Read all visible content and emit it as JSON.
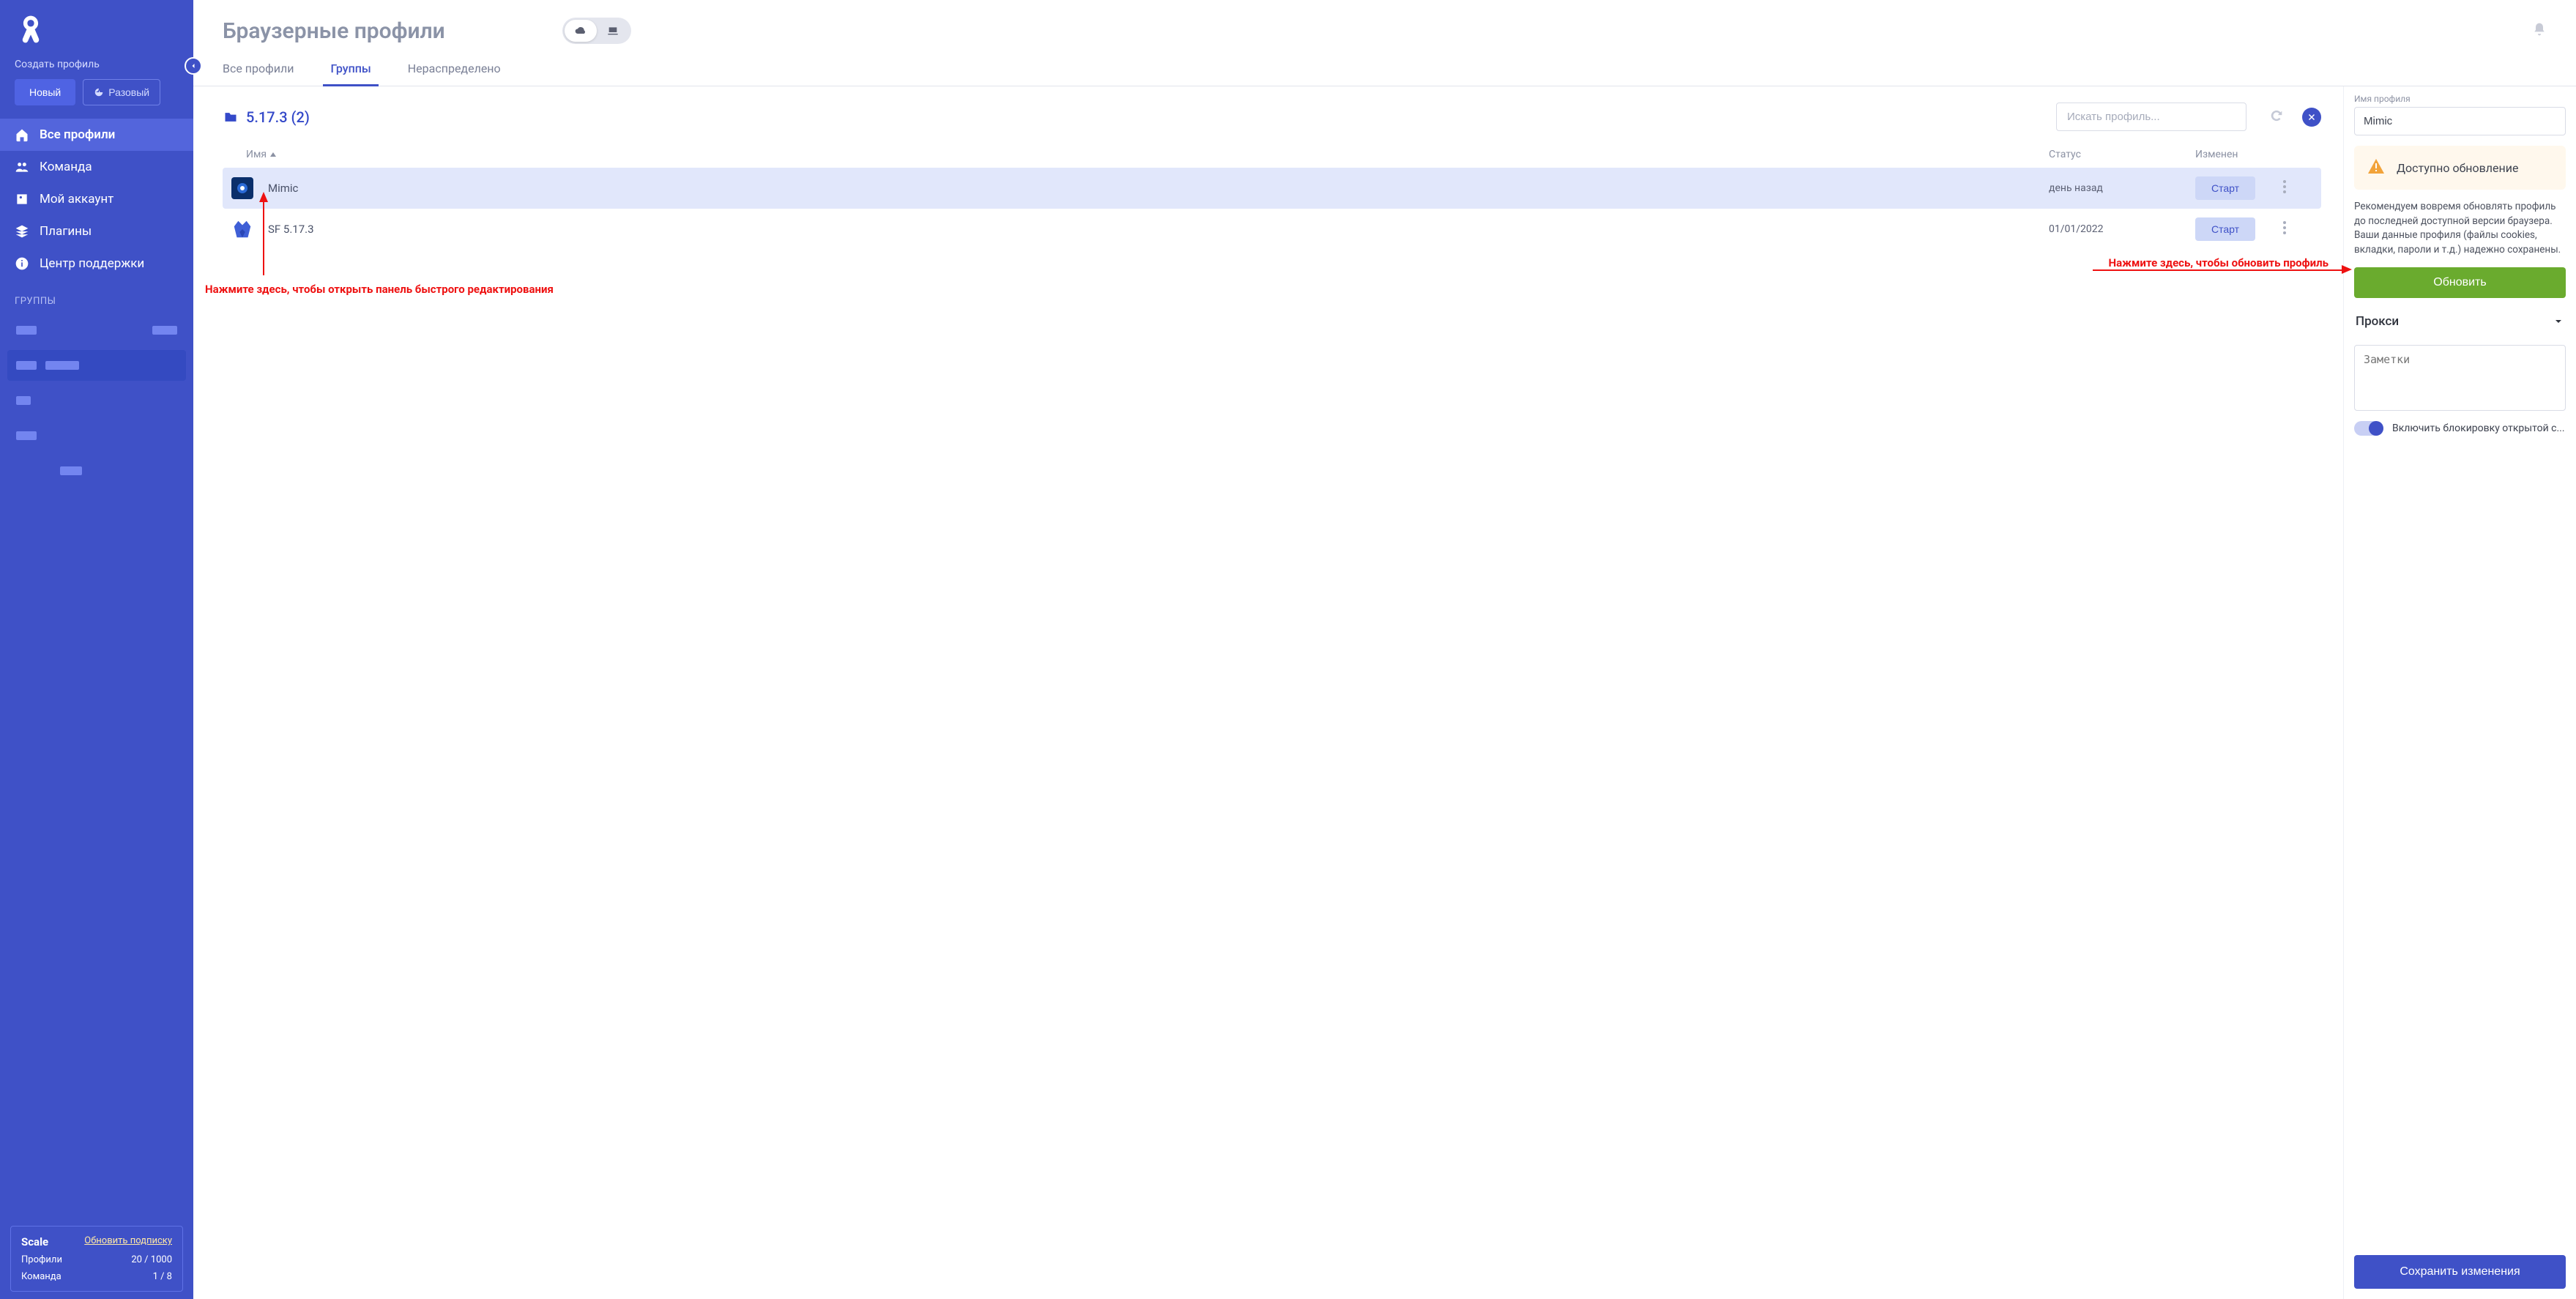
{
  "sidebar": {
    "create_label": "Создать профиль",
    "new_button": "Новый",
    "once_button": "Разовый",
    "nav": [
      {
        "label": "Все профили"
      },
      {
        "label": "Команда"
      },
      {
        "label": "Мой аккаунт"
      },
      {
        "label": "Плагины"
      },
      {
        "label": "Центр поддержки"
      }
    ],
    "groups_header": "ГРУППЫ",
    "subscription": {
      "plan": "Scale",
      "upgrade_link": "Обновить подписку",
      "profiles_label": "Профили",
      "profiles_value": "20 / 1000",
      "team_label": "Команда",
      "team_value": "1 / 8"
    }
  },
  "header": {
    "title": "Браузерные профили"
  },
  "tabs": [
    {
      "label": "Все профили"
    },
    {
      "label": "Группы"
    },
    {
      "label": "Нераспределено"
    }
  ],
  "folder": {
    "name": "5.17.3 (2)"
  },
  "search": {
    "placeholder": "Искать профиль..."
  },
  "table": {
    "col_name": "Имя",
    "col_status": "Статус",
    "col_modified": "Изменен",
    "rows": [
      {
        "name": "Mimic",
        "status": "",
        "modified": "день назад",
        "action": "Старт"
      },
      {
        "name": "SF 5.17.3",
        "status": "",
        "modified": "01/01/2022",
        "action": "Старт"
      }
    ]
  },
  "annotations": {
    "left": "Нажмите здесь, чтобы открыть панель быстрого редактирования",
    "right": "Нажмите здесь, чтобы обновить профиль"
  },
  "panel": {
    "name_label": "Имя профиля",
    "name_value": "Mimic",
    "update_available": "Доступно обновление",
    "update_text": "Рекомендуем вовремя обновлять профиль до последней доступной версии браузера. Ваши данные профиля (файлы cookies, вкладки, пароли и т.д.) надежно сохранены.",
    "update_button": "Обновить",
    "proxy_header": "Прокси",
    "notes_placeholder": "Заметки",
    "toggle_label": "Включить блокировку открытой с...",
    "save_button": "Сохранить изменения"
  }
}
